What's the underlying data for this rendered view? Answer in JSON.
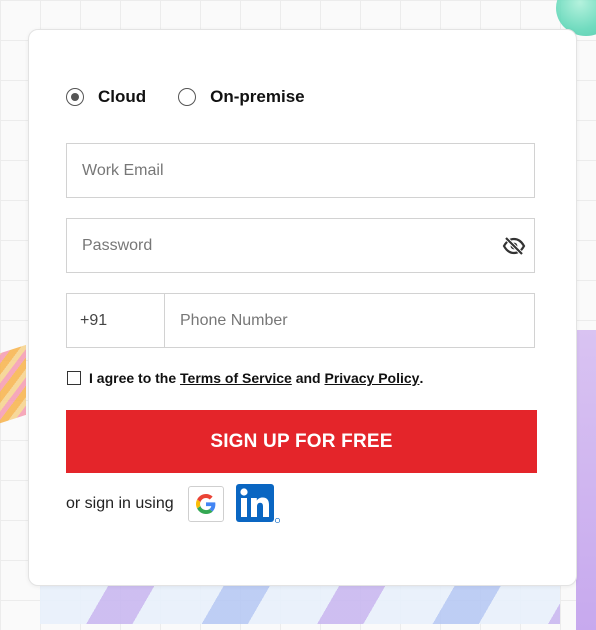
{
  "deployment": {
    "options": [
      {
        "label": "Cloud",
        "selected": true
      },
      {
        "label": "On-premise",
        "selected": false
      }
    ]
  },
  "form": {
    "email_placeholder": "Work Email",
    "password_placeholder": "Password",
    "password_icon": "eye-slash-icon",
    "country_code": "+91",
    "phone_placeholder": "Phone Number",
    "agree": {
      "prefix": "I agree to the",
      "terms_link": "Terms of Service",
      "joiner": "and",
      "privacy_link": "Privacy Policy",
      "suffix": ".",
      "checked": false
    },
    "submit_label": "SIGN UP FOR FREE"
  },
  "social": {
    "label": "or sign in using",
    "providers": [
      "google-icon",
      "linkedin-icon"
    ]
  },
  "colors": {
    "accent": "#e4252a",
    "linkedin": "#0a66c2"
  }
}
